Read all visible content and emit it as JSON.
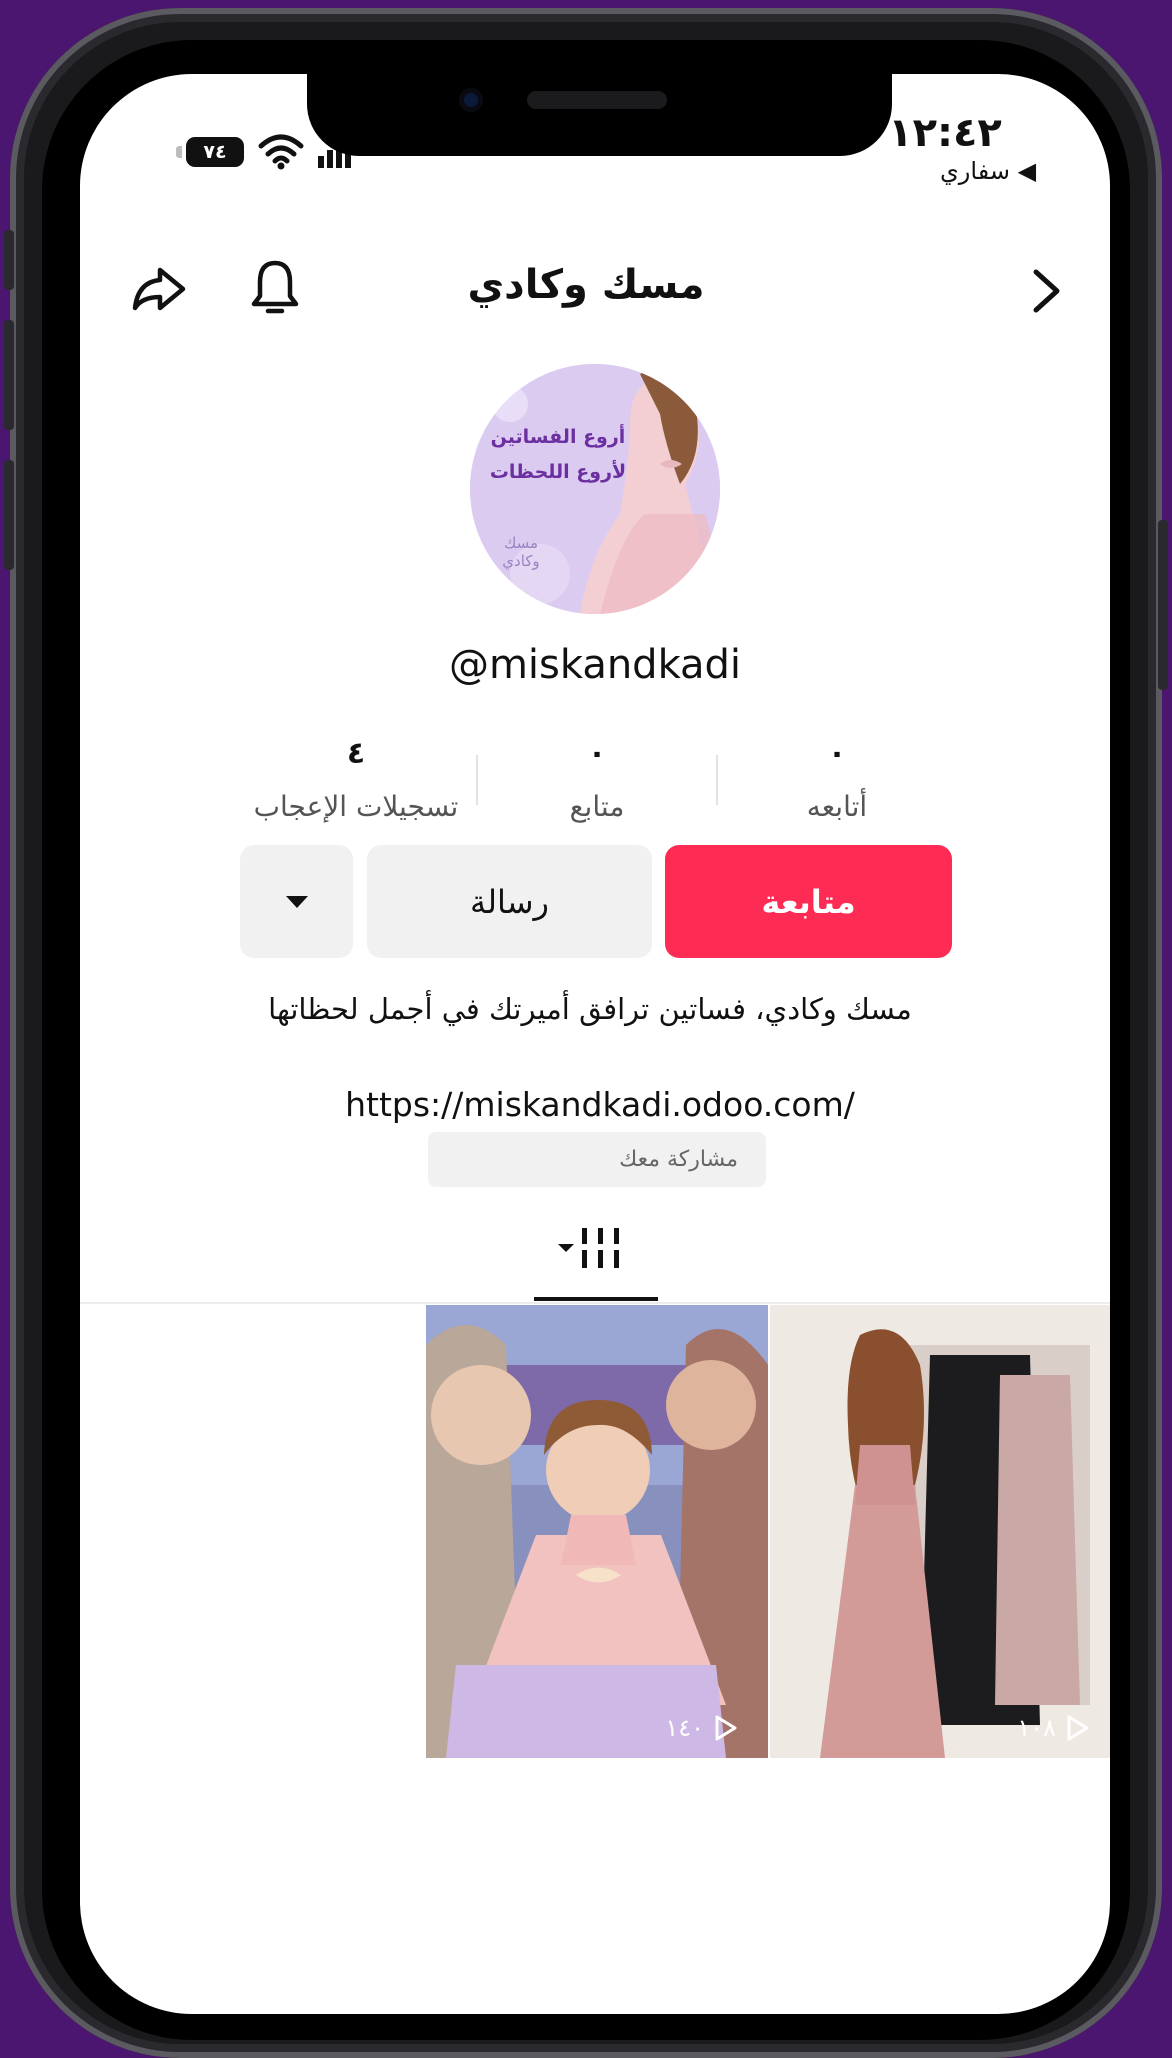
{
  "status_bar": {
    "time": "١٢:٤٢",
    "back_app": "سفاري",
    "battery": "٧٤"
  },
  "header": {
    "title": "مسك وكادي"
  },
  "profile": {
    "avatar_text_line1": "أروع الفساتين",
    "avatar_text_line2": "لأروع اللحظات",
    "avatar_logo_text": "مسك وكادي",
    "username": "@miskandkadi",
    "stats": [
      {
        "value": "٠",
        "label": "أتابعه"
      },
      {
        "value": "٠",
        "label": "متابع"
      },
      {
        "value": "٤",
        "label": "تسجيلات الإعجاب"
      }
    ],
    "follow_label": "متابعة",
    "message_label": "رسالة",
    "bio": "مسك وكادي، فساتين ترافق أميرتك في أجمل لحظاتها",
    "link": "https://miskandkadi.odoo.com/",
    "share_chip": "مشاركة معك"
  },
  "videos": [
    {
      "views": "١٠٨"
    },
    {
      "views": "١٤٠"
    }
  ],
  "colors": {
    "accent": "#fe2c55",
    "background": "#4a1670"
  }
}
